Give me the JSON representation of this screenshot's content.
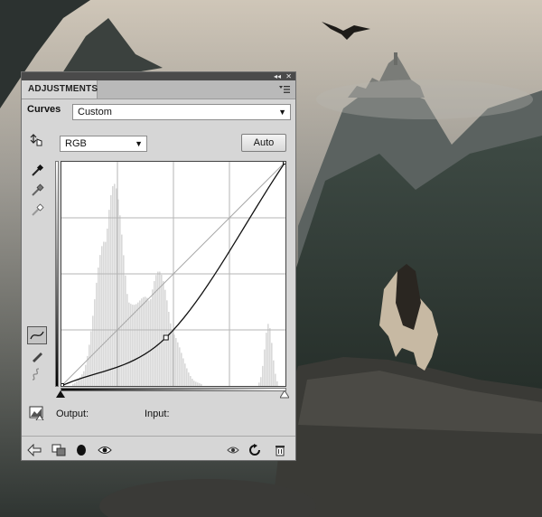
{
  "panel": {
    "tab_title": "ADJUSTMENTS",
    "window_controls": {
      "collapse": "◂◂",
      "close": "✕"
    },
    "adjustment_type": "Curves",
    "preset": {
      "value": "Custom"
    },
    "channel": {
      "value": "RGB"
    },
    "auto_button": "Auto",
    "output_label": "Output:",
    "input_label": "Input:",
    "output_value": "",
    "input_value": ""
  },
  "curve": {
    "points": [
      [
        0,
        0
      ],
      [
        119,
        55
      ],
      [
        255,
        255
      ]
    ],
    "histogram_color": "#d9d9d9",
    "curve_color": "#111111"
  },
  "icons": {
    "on_image_adjust": "hand-adjust-icon",
    "black_point": "black-eyedropper-icon",
    "gray_point": "gray-eyedropper-icon",
    "white_point": "white-eyedropper-icon",
    "curve_tool": "curve-edit-icon",
    "pencil_tool": "pencil-icon",
    "smooth_tool": "smooth-icon",
    "clipping_warning": "clipping-warning-icon",
    "footer": [
      "return-arrow-icon",
      "clip-layer-icon",
      "layer-mask-icon",
      "visibility-eye-icon",
      "view-previous-icon",
      "reset-icon",
      "trash-icon"
    ]
  },
  "colors": {
    "panel_bg": "#d6d6d6",
    "tab_bar": "#b9b9b9",
    "top_strip": "#4a4a4a"
  }
}
